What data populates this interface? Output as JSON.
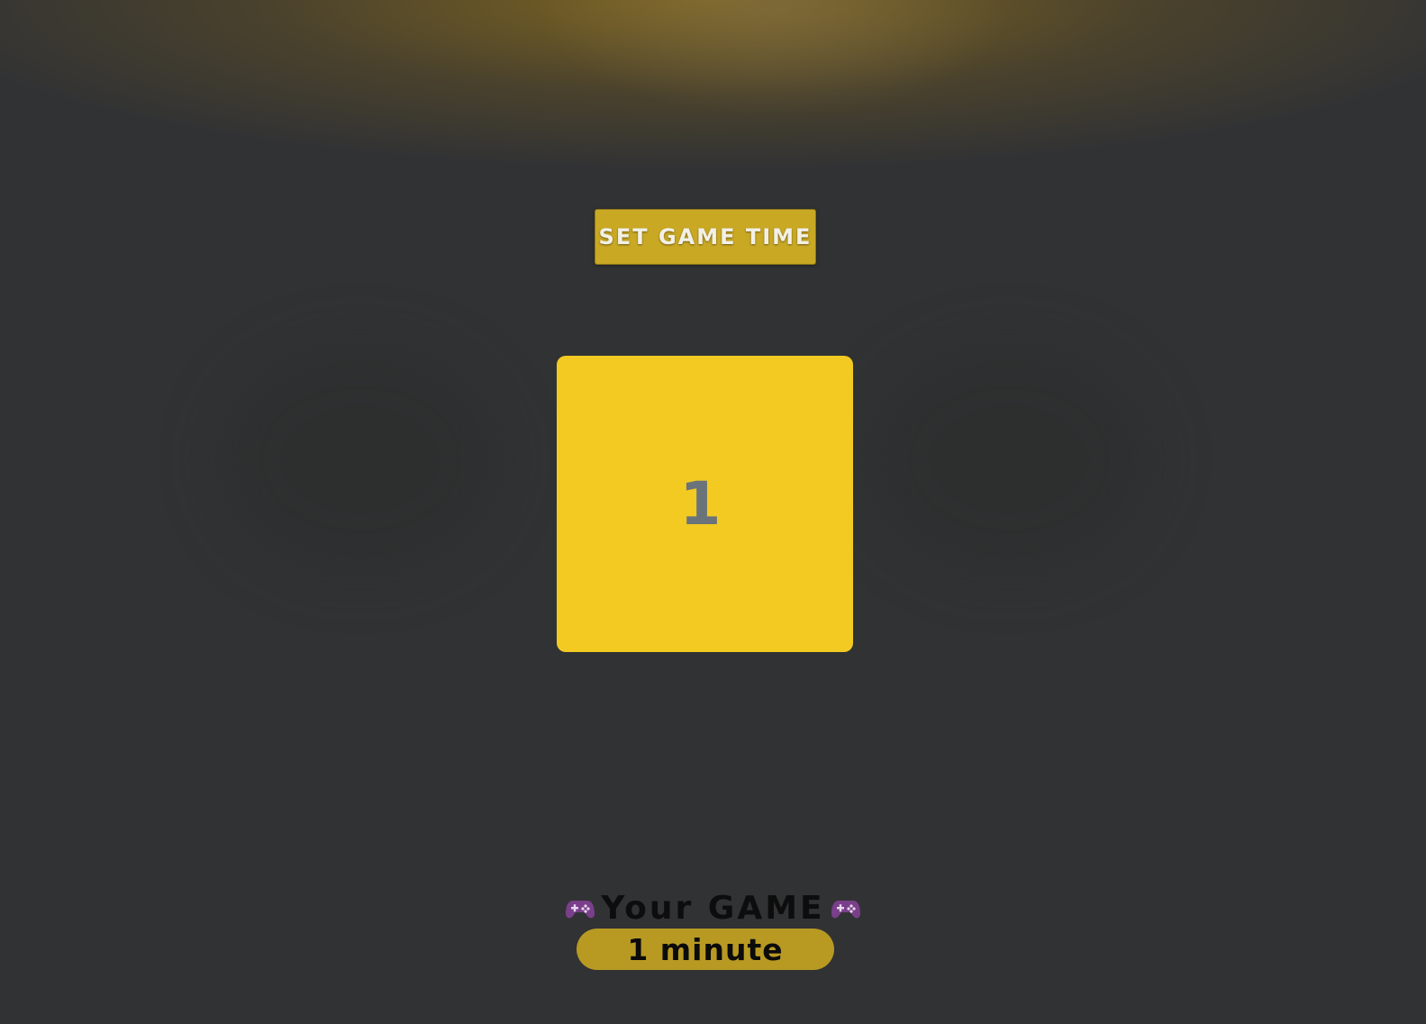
{
  "controls": {
    "set_time_label": "SET GAME TIME"
  },
  "board": {
    "tile_value": "1"
  },
  "footer": {
    "title": "Your GAME",
    "duration": "1 minute",
    "icons": [
      "gamepad-icon",
      "gamepad-icon"
    ]
  },
  "colors": {
    "background": "#313234",
    "button": "#c9a824",
    "tile": "#f2ca22",
    "pill": "#b89a23",
    "icon": "#7a3f8a"
  }
}
